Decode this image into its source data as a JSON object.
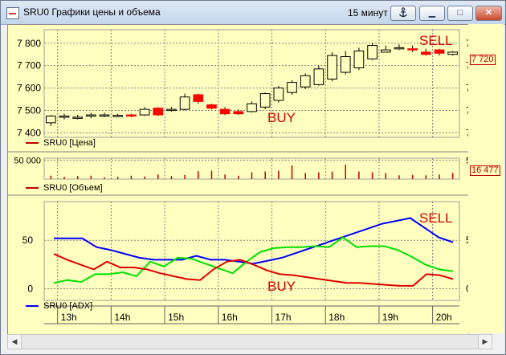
{
  "window": {
    "title": "SRU0 Графики цены и объема",
    "interval": "15 минут",
    "anchor_icon": "anchor-icon",
    "buttons": [
      "minimize-icon",
      "maximize-icon",
      "close-icon"
    ],
    "minimize_label": "▁",
    "maximize_label": "□",
    "close_label": "✕"
  },
  "colors": {
    "background": "#ffffc0",
    "candle_up": "#ffffc0",
    "candle_down": "#ff0000",
    "volume": "#c00000",
    "adx": "#0000ff",
    "plus_di": "#00e000",
    "minus_di": "#e00000",
    "signal": "#d00000"
  },
  "price_panel": {
    "legend": "SRU0 [Цена]",
    "last_value": "7 720",
    "ticks": [
      "7 800",
      "7 700",
      "7 600",
      "7 500",
      "7 400"
    ],
    "signal_sell": "SELL",
    "signal_buy": "BUY"
  },
  "volume_panel": {
    "legend": "SRU0 [Объем]",
    "top_tick": "50 000",
    "last_value": "16 477"
  },
  "adx_panel": {
    "legend": "SRU0 [ADX]",
    "ticks": [
      "50",
      "0"
    ],
    "signal_sell": "SELL",
    "signal_buy": "BUY"
  },
  "time_axis": {
    "labels": [
      "13h",
      "14h",
      "15h",
      "16h",
      "17h",
      "18h",
      "19h",
      "20h"
    ]
  },
  "chart_data": [
    {
      "type": "candlestick",
      "title": "SRU0 [Цена]",
      "x": [
        "12:45",
        "13:00",
        "13:15",
        "13:30",
        "13:45",
        "14:00",
        "14:15",
        "14:30",
        "14:45",
        "15:00",
        "15:15",
        "15:30",
        "15:45",
        "16:00",
        "16:15",
        "16:30",
        "16:45",
        "17:00",
        "17:15",
        "17:30",
        "17:45",
        "18:00",
        "18:15",
        "18:30",
        "18:45",
        "19:00",
        "19:15",
        "19:30",
        "19:45",
        "20:00",
        "20:15"
      ],
      "open": [
        7445,
        7470,
        7470,
        7475,
        7480,
        7478,
        7480,
        7480,
        7510,
        7500,
        7505,
        7570,
        7525,
        7505,
        7495,
        7495,
        7515,
        7545,
        7580,
        7605,
        7615,
        7640,
        7670,
        7690,
        7730,
        7760,
        7780,
        7775,
        7760,
        7770,
        7750
      ],
      "close": [
        7475,
        7475,
        7470,
        7480,
        7480,
        7478,
        7478,
        7505,
        7480,
        7505,
        7560,
        7540,
        7510,
        7485,
        7485,
        7530,
        7575,
        7600,
        7625,
        7655,
        7685,
        7745,
        7740,
        7765,
        7790,
        7770,
        7780,
        7770,
        7750,
        7755,
        7760
      ],
      "high": [
        7480,
        7485,
        7480,
        7490,
        7490,
        7485,
        7485,
        7515,
        7515,
        7515,
        7575,
        7575,
        7530,
        7515,
        7505,
        7540,
        7580,
        7610,
        7635,
        7665,
        7700,
        7760,
        7765,
        7780,
        7800,
        7790,
        7795,
        7790,
        7775,
        7775,
        7765
      ],
      "low": [
        7430,
        7460,
        7460,
        7465,
        7470,
        7470,
        7470,
        7475,
        7475,
        7495,
        7500,
        7530,
        7505,
        7480,
        7480,
        7490,
        7505,
        7535,
        7570,
        7595,
        7610,
        7630,
        7660,
        7680,
        7725,
        7760,
        7770,
        7760,
        7745,
        7745,
        7745
      ],
      "ylim": [
        7380,
        7860
      ],
      "ticks": [
        7400,
        7500,
        7600,
        7700,
        7800
      ],
      "last": 7720,
      "annotations": [
        "SELL",
        "BUY"
      ]
    },
    {
      "type": "bar",
      "title": "SRU0 [Объем]",
      "values": [
        9000,
        6000,
        8000,
        9000,
        5000,
        6000,
        9000,
        7000,
        12000,
        8000,
        11000,
        21000,
        22000,
        12000,
        9000,
        18000,
        20000,
        22000,
        36000,
        16000,
        18000,
        20000,
        38000,
        20000,
        18000,
        16000,
        10000,
        11000,
        10000,
        12000,
        16477
      ],
      "ylim": [
        0,
        55000
      ],
      "ticks": [
        50000
      ],
      "last": 16477
    },
    {
      "type": "line",
      "title": "SRU0 [ADX]",
      "x_ticks": [
        "13h",
        "14h",
        "15h",
        "16h",
        "17h",
        "18h",
        "19h",
        "20h"
      ],
      "series": [
        {
          "name": "SRU0 [ADX]",
          "values": [
            52,
            52,
            52,
            43,
            40,
            36,
            32,
            30,
            30,
            30,
            34,
            30,
            30,
            28,
            26,
            29,
            32,
            37,
            42,
            47,
            52,
            57,
            62,
            67,
            70,
            73,
            63,
            53,
            48
          ]
        },
        {
          "values": [
            6,
            9,
            7,
            15,
            15,
            17,
            13,
            28,
            23,
            32,
            31,
            26,
            21,
            16,
            28,
            38,
            42,
            43,
            43,
            44,
            43,
            53,
            43,
            44,
            44,
            40,
            33,
            25,
            20,
            18
          ]
        },
        {
          "values": [
            36,
            30,
            25,
            20,
            28,
            22,
            22,
            20,
            16,
            13,
            10,
            9,
            20,
            28,
            30,
            25,
            19,
            15,
            14,
            12,
            10,
            8,
            6,
            6,
            5,
            4,
            3,
            3,
            15,
            14,
            10
          ]
        }
      ],
      "ylim": [
        -12,
        90
      ],
      "ticks": [
        0,
        50
      ],
      "annotations": [
        "SELL",
        "BUY"
      ]
    }
  ]
}
